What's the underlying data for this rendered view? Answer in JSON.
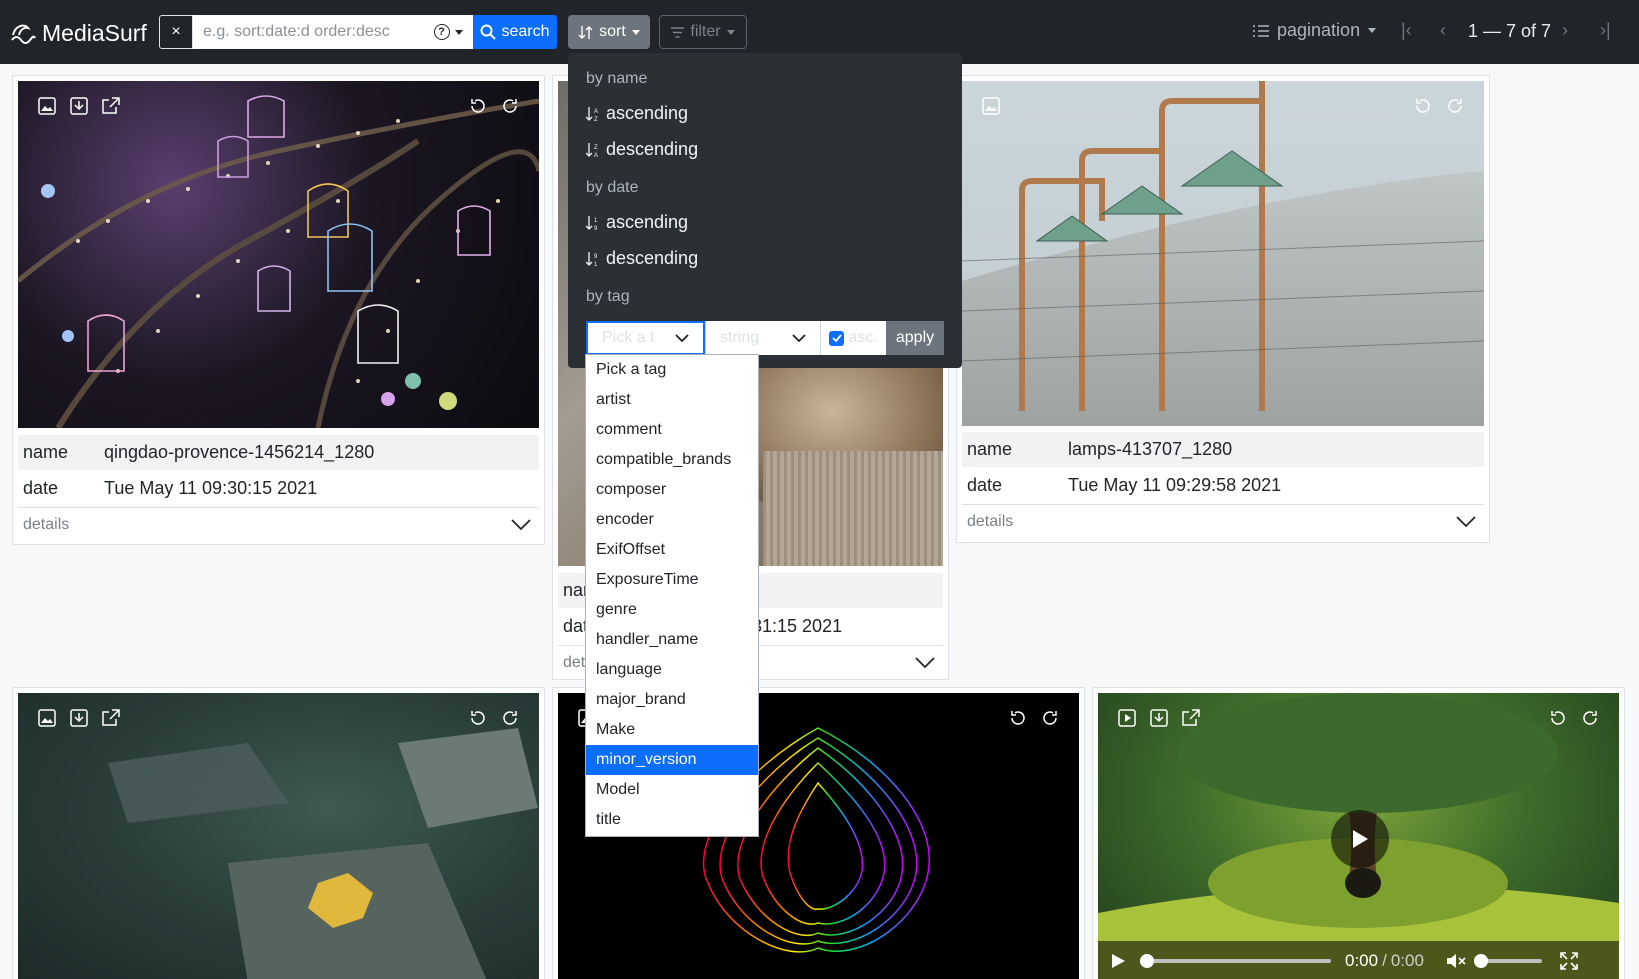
{
  "app": {
    "name": "MediaSurf"
  },
  "search": {
    "clear_label": "×",
    "placeholder": "e.g. sort:date:d order:desc",
    "help_label": "?",
    "button_label": "search"
  },
  "toolbar": {
    "sort_label": "sort",
    "filter_label": "filter"
  },
  "pagination": {
    "label": "pagination",
    "range": "1 — 7 of 7",
    "first": "|‹",
    "prev": "‹",
    "next": "›",
    "last": "›|"
  },
  "sort_menu": {
    "by_name_header": "by name",
    "by_date_header": "by date",
    "by_tag_header": "by tag",
    "ascending": "ascending",
    "descending": "descending",
    "tag_select_value": "Pick a t",
    "type_select_value": "string",
    "asc_label": "asc.",
    "apply_label": "apply"
  },
  "tag_options": [
    "Pick a tag",
    "artist",
    "comment",
    "compatible_brands",
    "composer",
    "encoder",
    "ExifOffset",
    "ExposureTime",
    "genre",
    "handler_name",
    "language",
    "major_brand",
    "Make",
    "minor_version",
    "Model",
    "title"
  ],
  "tag_options_selected": "minor_version",
  "cards": [
    {
      "name_key": "name",
      "name": "qingdao-provence-1456214_1280",
      "date_key": "date",
      "date": "Tue May 11 09:30:15 2021",
      "details": "details"
    },
    {
      "name_key": "nar",
      "name": "",
      "date_key": "dat",
      "date": "31:15 2021",
      "details": "det"
    },
    {
      "name_key": "name",
      "name": "lamps-413707_1280",
      "date_key": "date",
      "date": "Tue May 11 09:29:58 2021",
      "details": "details"
    }
  ],
  "video": {
    "time": "0:00",
    "duration": "0:00"
  },
  "colors": {
    "navbar": "#212529",
    "primary": "#0d6efd",
    "secondary": "#6c757d",
    "menu_bg": "#2b3035"
  }
}
